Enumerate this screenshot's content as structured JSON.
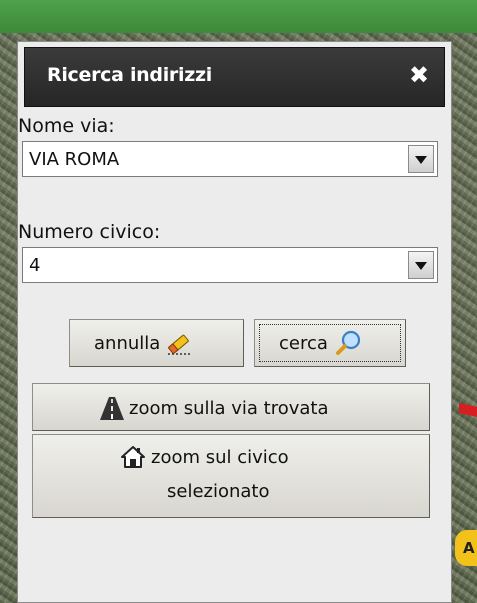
{
  "panel": {
    "title": "Ricerca indirizzi",
    "close_icon": "close-icon"
  },
  "street": {
    "label": "Nome via:",
    "value": "VIA ROMA"
  },
  "civic": {
    "label": "Numero civico:",
    "value": "4"
  },
  "buttons": {
    "cancel_label": "annulla",
    "cancel_icon": "eraser-icon",
    "search_label": "cerca",
    "search_icon": "magnifier-icon",
    "zoom_street_label": "zoom sulla via trovata",
    "zoom_street_icon": "road-icon",
    "zoom_civic_label_line1": "zoom sul civico",
    "zoom_civic_label_line2": "selezionato",
    "zoom_civic_icon": "house-icon"
  },
  "map": {
    "label_fragment": "A"
  },
  "colors": {
    "topbar": "#45994a",
    "header": "#2e2e2e",
    "panel": "#ececec",
    "button": "#e4e2dc"
  }
}
